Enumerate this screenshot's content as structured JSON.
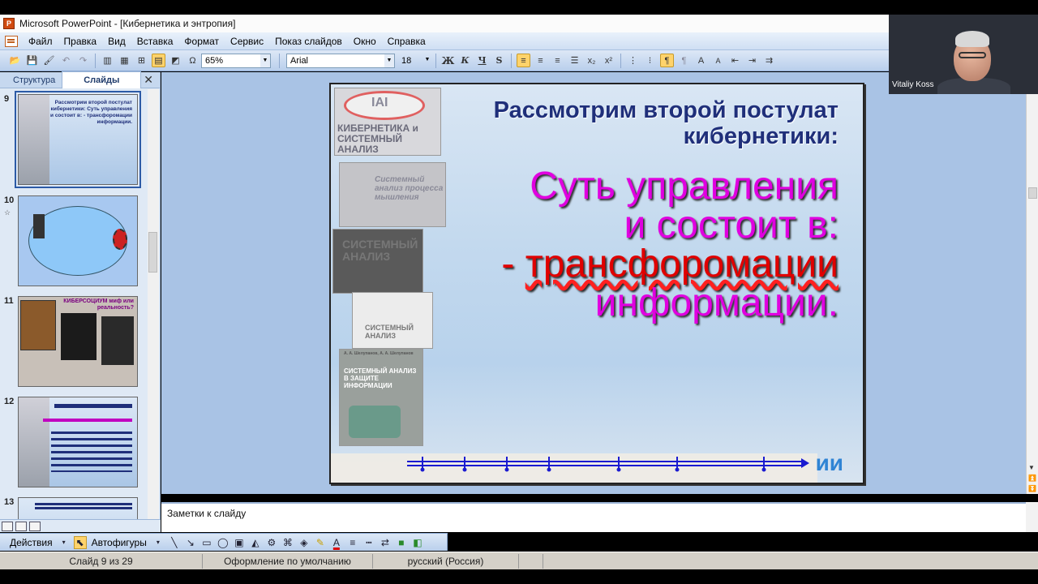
{
  "window": {
    "title": "Microsoft PowerPoint - [Кибернетика и энтропия]"
  },
  "menu": [
    "Файл",
    "Правка",
    "Вид",
    "Вставка",
    "Формат",
    "Сервис",
    "Показ слайдов",
    "Окно",
    "Справка"
  ],
  "toolbar": {
    "zoom": "65%",
    "font": "Arial",
    "size": "18"
  },
  "left_panel": {
    "tabs": [
      "Структура",
      "Слайды"
    ],
    "active_tab": "Слайды",
    "close_icon": "close-icon",
    "slides": [
      {
        "num": "9"
      },
      {
        "num": "10"
      },
      {
        "num": "11"
      },
      {
        "num": "12"
      },
      {
        "num": "13"
      }
    ]
  },
  "slide": {
    "title": "Рассмотрим второй постулат кибернетики:",
    "body_line1": "Суть управления",
    "body_line2": "и состоит в:",
    "body_dash": "- ",
    "body_red": "трансфоромации",
    "body_line4": "информации.",
    "bottom_text": "ии",
    "book_texts": [
      "IAI",
      "КИБЕРНЕТИКА и СИСТЕМНЫЙ АНАЛИЗ",
      "Системный анализ процесса мышления",
      "СИСТЕМНЫЙ АНАЛИЗ",
      "СИСТЕМНЫЙ АНАЛИЗ",
      "А. А. Шелупанов, А. А. Шелупанов",
      "СИСТЕМНЫЙ АНАЛИЗ В ЗАЩИТЕ ИНФОРМАЦИИ"
    ],
    "thumb_texts": {
      "t9": "Рассмотрим второй постулат кибернетики: Суть управления и состоит в: - трансфоромации информации.",
      "t11": "КИБЕРСОЦИУМ миф или реальность?"
    }
  },
  "notes": {
    "placeholder": "Заметки к слайду"
  },
  "drawbar": {
    "actions": "Действия",
    "autoshapes": "Автофигуры"
  },
  "status": {
    "slide_of": "Слайд 9 из 29",
    "design": "Оформление по умолчанию",
    "language": "русский (Россия)"
  },
  "video": {
    "name": "Vitaliy Koss"
  },
  "colors": {
    "slide_title": "#1f2f7a",
    "slide_body": "#e000e0",
    "slide_emphasis": "#e00000"
  }
}
